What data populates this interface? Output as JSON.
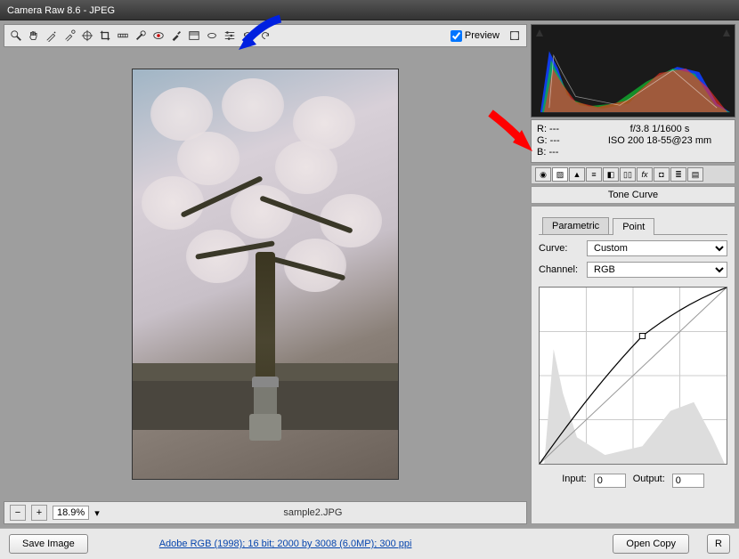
{
  "title": "Camera Raw 8.6  -  JPEG",
  "preview_label": "Preview",
  "preview_checked": true,
  "tools": [
    {
      "name": "zoom-icon"
    },
    {
      "name": "hand-icon"
    },
    {
      "name": "white-balance-icon"
    },
    {
      "name": "color-sampler-icon"
    },
    {
      "name": "target-adjust-icon"
    },
    {
      "name": "crop-icon"
    },
    {
      "name": "straighten-icon"
    },
    {
      "name": "spot-removal-icon"
    },
    {
      "name": "redeye-icon"
    },
    {
      "name": "adjustment-brush-icon"
    },
    {
      "name": "graduated-filter-icon"
    },
    {
      "name": "radial-filter-icon"
    },
    {
      "name": "preferences-icon"
    },
    {
      "name": "rotate-ccw-icon"
    },
    {
      "name": "rotate-cw-icon"
    }
  ],
  "zoom_level": "18.9%",
  "filename": "sample2.JPG",
  "save_label": "Save Image",
  "workflow_link": "Adobe RGB (1998); 16 bit; 2000 by 3008 (6.0MP); 300 ppi",
  "open_label": "Open Copy",
  "reset_label": "R",
  "rgb_readout": {
    "r": "R:   ---",
    "g": "G:   ---",
    "b": "B:   ---"
  },
  "meta": {
    "line1": "f/3.8   1/1600 s",
    "line2": "ISO 200   18-55@23 mm"
  },
  "panel_icons": [
    {
      "name": "basic-icon",
      "glyph": "◉"
    },
    {
      "name": "tone-curve-icon",
      "glyph": "▨"
    },
    {
      "name": "detail-icon",
      "glyph": "▲"
    },
    {
      "name": "hsl-icon",
      "glyph": "≡"
    },
    {
      "name": "split-tone-icon",
      "glyph": "◧"
    },
    {
      "name": "lens-icon",
      "glyph": "▯▯"
    },
    {
      "name": "effects-icon",
      "glyph": "fx"
    },
    {
      "name": "camera-cal-icon",
      "glyph": "◘"
    },
    {
      "name": "presets-icon",
      "glyph": "≣"
    },
    {
      "name": "snapshots-icon",
      "glyph": "▤"
    }
  ],
  "panel_title": "Tone Curve",
  "subtabs": {
    "parametric": "Parametric",
    "point": "Point"
  },
  "curve_label": "Curve:",
  "curve_value": "Custom",
  "channel_label": "Channel:",
  "channel_value": "RGB",
  "input_label": "Input:",
  "input_value": "0",
  "output_label": "Output:",
  "output_value": "0"
}
